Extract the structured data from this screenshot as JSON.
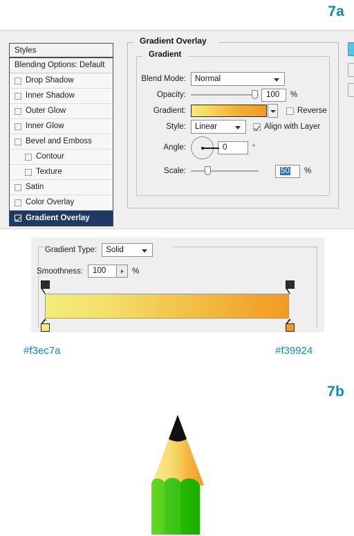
{
  "figures": {
    "label_a": "7a",
    "label_b": "7b"
  },
  "swatch_labels": {
    "left": "#f3ec7a",
    "right": "#f39924"
  },
  "layer_style_dialog": {
    "styles_panel": {
      "header": "Styles",
      "items": [
        {
          "label": "Blending Options: Default",
          "checkbox": false,
          "indent": false,
          "selected": false,
          "has_checkbox": false
        },
        {
          "label": "Drop Shadow",
          "checkbox": false,
          "indent": false,
          "selected": false,
          "has_checkbox": true
        },
        {
          "label": "Inner Shadow",
          "checkbox": false,
          "indent": false,
          "selected": false,
          "has_checkbox": true
        },
        {
          "label": "Outer Glow",
          "checkbox": false,
          "indent": false,
          "selected": false,
          "has_checkbox": true
        },
        {
          "label": "Inner Glow",
          "checkbox": false,
          "indent": false,
          "selected": false,
          "has_checkbox": true
        },
        {
          "label": "Bevel and Emboss",
          "checkbox": false,
          "indent": false,
          "selected": false,
          "has_checkbox": true
        },
        {
          "label": "Contour",
          "checkbox": false,
          "indent": true,
          "selected": false,
          "has_checkbox": true
        },
        {
          "label": "Texture",
          "checkbox": false,
          "indent": true,
          "selected": false,
          "has_checkbox": true
        },
        {
          "label": "Satin",
          "checkbox": false,
          "indent": false,
          "selected": false,
          "has_checkbox": true
        },
        {
          "label": "Color Overlay",
          "checkbox": false,
          "indent": false,
          "selected": false,
          "has_checkbox": true
        },
        {
          "label": "Gradient Overlay",
          "checkbox": true,
          "indent": false,
          "selected": true,
          "has_checkbox": true
        }
      ]
    },
    "section_title": "Gradient Overlay",
    "group_title": "Gradient",
    "fields": {
      "blend_mode_label": "Blend Mode:",
      "blend_mode_value": "Normal",
      "opacity_label": "Opacity:",
      "opacity_value": "100",
      "opacity_unit": "%",
      "gradient_label": "Gradient:",
      "reverse_label": "Reverse",
      "reverse_checked": false,
      "style_label": "Style:",
      "style_value": "Linear",
      "align_label": "Align with Layer",
      "align_checked": true,
      "angle_label": "Angle:",
      "angle_value": "0",
      "angle_unit": "°",
      "scale_label": "Scale:",
      "scale_value": "50",
      "scale_unit": "%"
    },
    "gradient_preview": {
      "start_color": "#f3ec7a",
      "end_color": "#f39924"
    }
  },
  "gradient_editor_dialog": {
    "gradient_type_label": "Gradient Type:",
    "gradient_type_value": "Solid",
    "smoothness_label": "Smoothness:",
    "smoothness_value": "100",
    "smoothness_unit": "%",
    "ramp": {
      "start_color": "#f3ec7a",
      "end_color": "#f39924",
      "left_stop_position": "0",
      "right_stop_position": "100"
    }
  },
  "pencil": {
    "tip_color": "#111111",
    "wood_left_color": "#f7e98b",
    "wood_right_color": "#f2a02d",
    "barrel_left_color": "#5fd41f",
    "barrel_mid_color": "#3ec51a",
    "barrel_right_color": "#23b800"
  }
}
